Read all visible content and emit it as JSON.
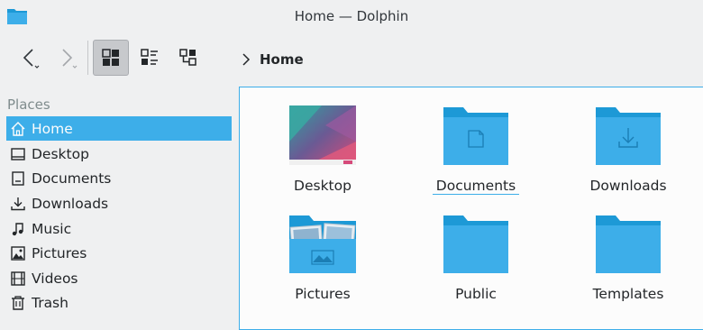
{
  "window": {
    "title": "Home — Dolphin"
  },
  "icons": {
    "app": "folder-icon",
    "back": "chevron-left-icon",
    "forward": "chevron-right-icon",
    "icons_view": "grid-view-icon",
    "compact_view": "compact-list-icon",
    "details_view": "tree-view-icon",
    "breadcrumb_sep": "chevron-right-icon"
  },
  "breadcrumb": {
    "current": "Home"
  },
  "sidebar": {
    "header": "Places",
    "items": [
      {
        "label": "Home",
        "icon": "home-icon",
        "selected": true
      },
      {
        "label": "Desktop",
        "icon": "monitor-icon"
      },
      {
        "label": "Documents",
        "icon": "document-icon"
      },
      {
        "label": "Downloads",
        "icon": "download-icon"
      },
      {
        "label": "Music",
        "icon": "music-note-icon"
      },
      {
        "label": "Pictures",
        "icon": "picture-icon"
      },
      {
        "label": "Videos",
        "icon": "film-icon"
      },
      {
        "label": "Trash",
        "icon": "trash-icon"
      }
    ]
  },
  "files": [
    {
      "label": "Desktop",
      "icon": "desktop-thumbnail"
    },
    {
      "label": "Documents",
      "icon": "folder-documents-icon",
      "focused": true
    },
    {
      "label": "Downloads",
      "icon": "folder-download-icon"
    },
    {
      "label": "Pictures",
      "icon": "folder-pictures-icon"
    },
    {
      "label": "Public",
      "icon": "folder-icon"
    },
    {
      "label": "Templates",
      "icon": "folder-icon"
    }
  ],
  "colors": {
    "accent": "#3daee9",
    "folder": "#3daee9",
    "folder_back": "#1d99d6"
  }
}
